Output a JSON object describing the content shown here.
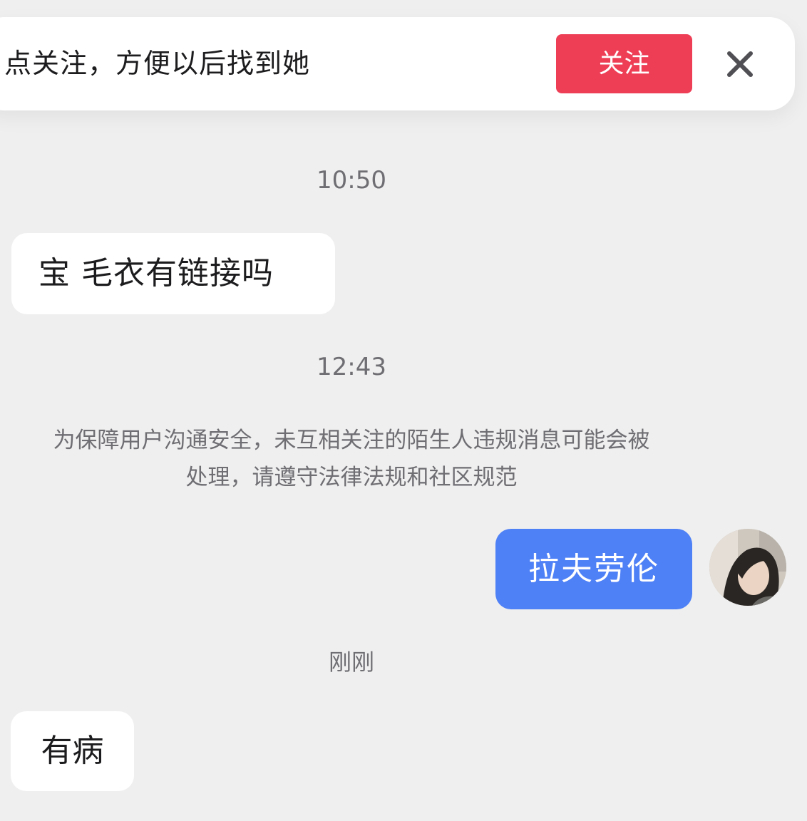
{
  "follow_banner": {
    "text": "点关注，方便以后找到她",
    "follow_button_label": "关注",
    "close_icon": "close-icon",
    "accent_color": "#ee3e56"
  },
  "messages": [
    {
      "timestamp": "10:50",
      "direction": "incoming",
      "text": "宝  毛衣有链接吗"
    },
    {
      "timestamp": "12:43",
      "direction": "system",
      "text_line1": "为保障用户沟通安全，未互相关注的陌生人违规消息可能会被",
      "text_line2": "处理，请遵守法律法规和社区规范"
    },
    {
      "direction": "outgoing",
      "text": "拉夫劳伦",
      "bubble_color": "#4e80f6"
    },
    {
      "timestamp": "刚刚",
      "direction": "incoming",
      "text": "有病"
    }
  ]
}
